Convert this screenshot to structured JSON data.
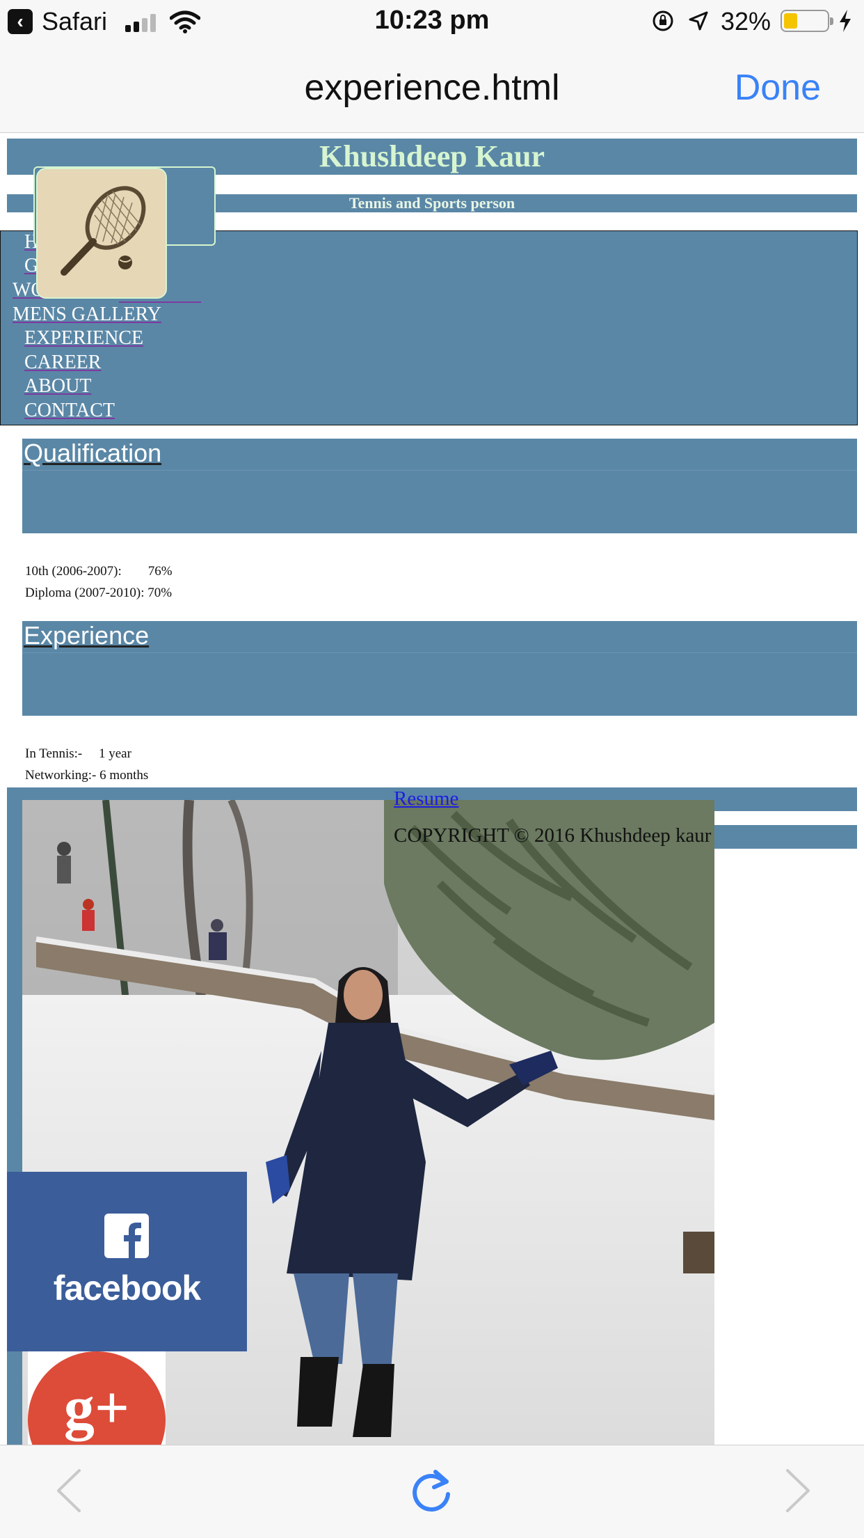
{
  "status_bar": {
    "back_app": "Safari",
    "time": "10:23 pm",
    "battery_percent": "32%",
    "battery_level": 0.32
  },
  "safari": {
    "document_title": "experience.html",
    "done_label": "Done"
  },
  "page": {
    "site_name": "Khushdeep Kaur",
    "tagline": "Tennis and Sports person",
    "nav": [
      "H",
      "G",
      "WO",
      "MENS GALLERY",
      "EXPERIENCE",
      "CAREER",
      "ABOUT",
      "CONTACT"
    ],
    "qualification": {
      "title": "Qualification",
      "rows": [
        "10th (2006-2007):        76%",
        "Diploma (2007-2010): 70%"
      ]
    },
    "experience": {
      "title": "Experience",
      "rows": [
        "In Tennis:-     1 year",
        "Networking:- 6 months"
      ]
    },
    "resume_link": "Resume",
    "copyright": "COPYRIGHT © 2016 Khushdeep kaur",
    "social": {
      "facebook_label": "facebook"
    }
  },
  "colors": {
    "header_blue": "#5a87a6",
    "name_green": "#d6f5d0",
    "link_blue": "#1d1de3",
    "ios_blue": "#3a82f7",
    "facebook_blue": "#3b5d9a",
    "gplus_red": "#dd4b39"
  }
}
